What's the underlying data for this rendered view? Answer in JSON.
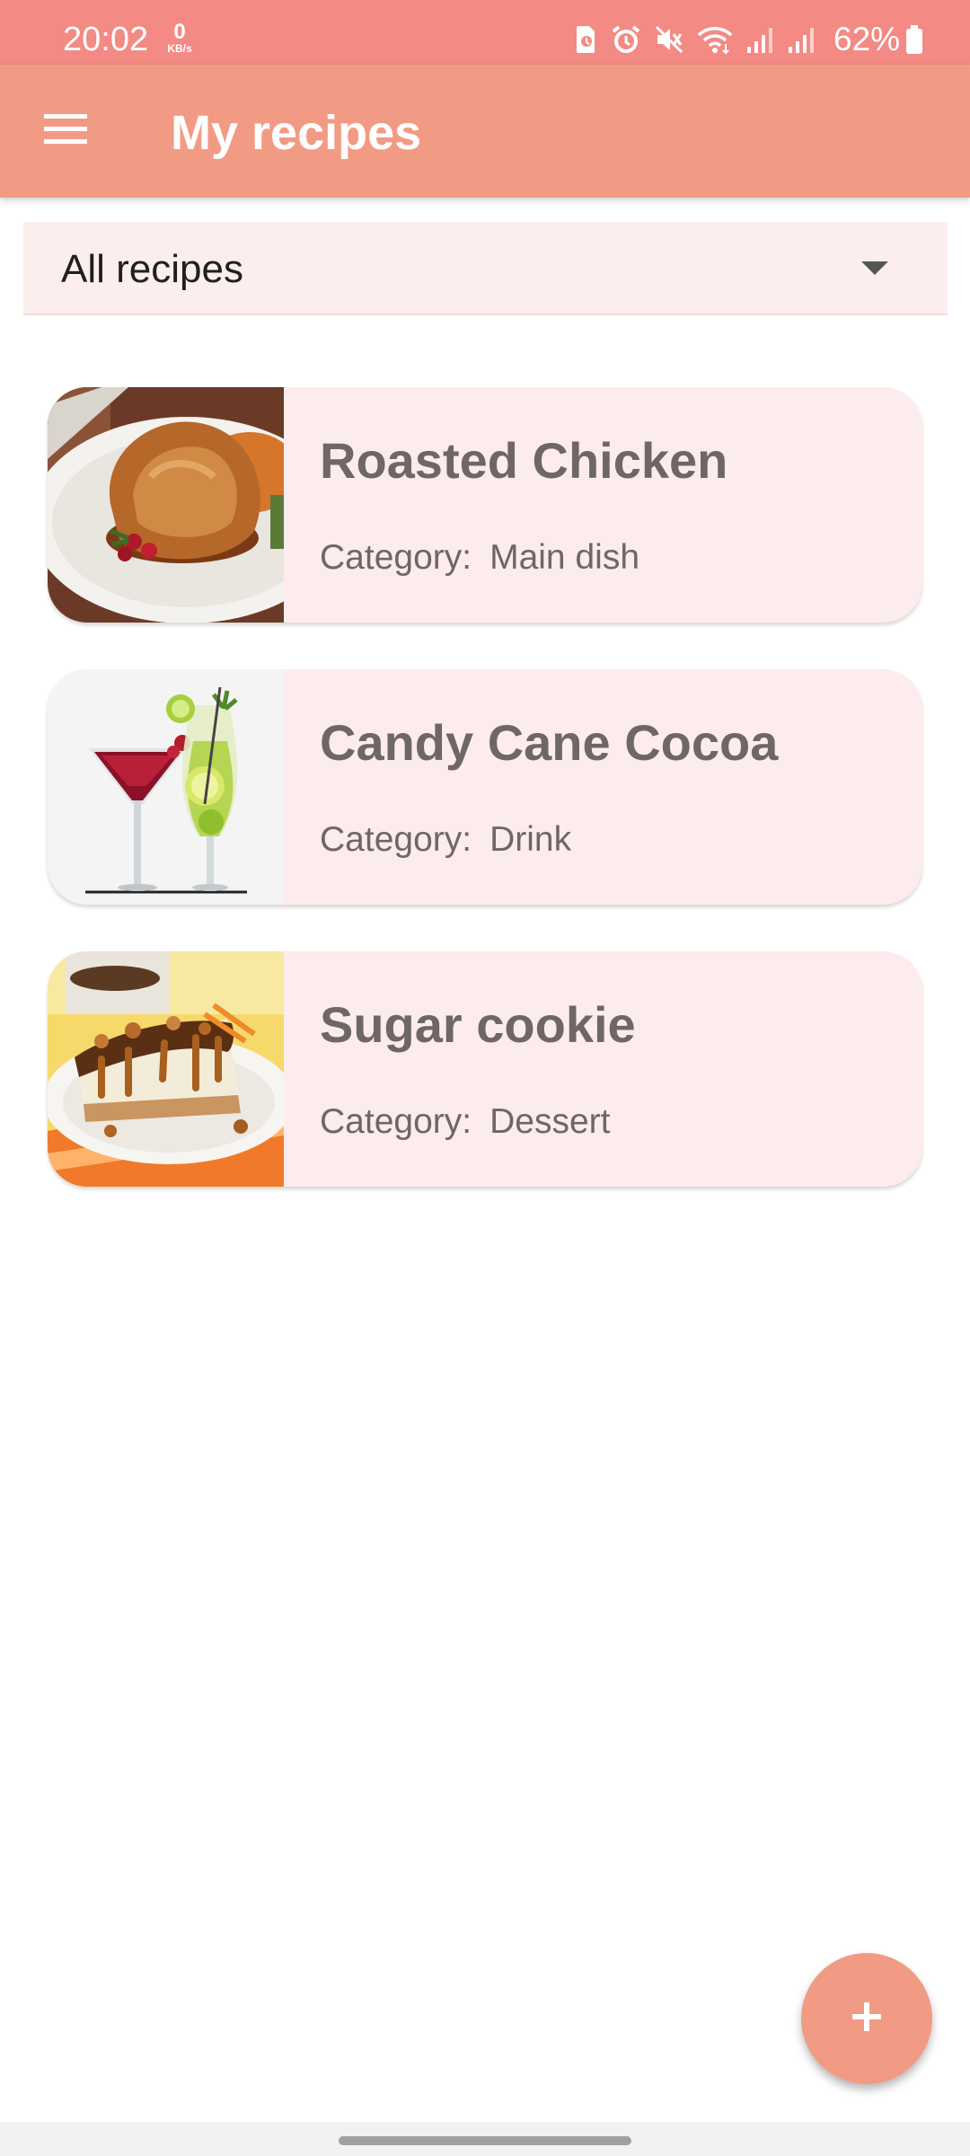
{
  "status_bar": {
    "time": "20:02",
    "net_speed_value": "0",
    "net_speed_unit": "KB/s",
    "battery_percent": "62%",
    "icons": [
      "sim-status-icon",
      "alarm-icon",
      "mute-icon",
      "wifi-icon",
      "signal-icon",
      "signal-icon",
      "battery-icon"
    ]
  },
  "app_bar": {
    "title": "My recipes",
    "menu_icon": "hamburger-menu-icon",
    "color": "#f29b84"
  },
  "filter": {
    "selected": "All recipes",
    "icon": "dropdown-arrow-icon"
  },
  "recipes": [
    {
      "name": "Roasted Chicken",
      "category_label": "Category:",
      "category": "Main dish",
      "image": "roasted-chicken-photo"
    },
    {
      "name": "Candy Cane Cocoa",
      "category_label": "Category:",
      "category": "Drink",
      "image": "cocktails-photo"
    },
    {
      "name": "Sugar cookie",
      "category_label": "Category:",
      "category": "Dessert",
      "image": "caramel-cheesecake-photo"
    }
  ],
  "fab": {
    "icon": "plus-icon"
  },
  "colors": {
    "status_bar": "#f38a84",
    "app_bar": "#f29b84",
    "card_background": "#fdeced",
    "card_text": "#6e6766",
    "filter_background": "#fdeeee"
  }
}
